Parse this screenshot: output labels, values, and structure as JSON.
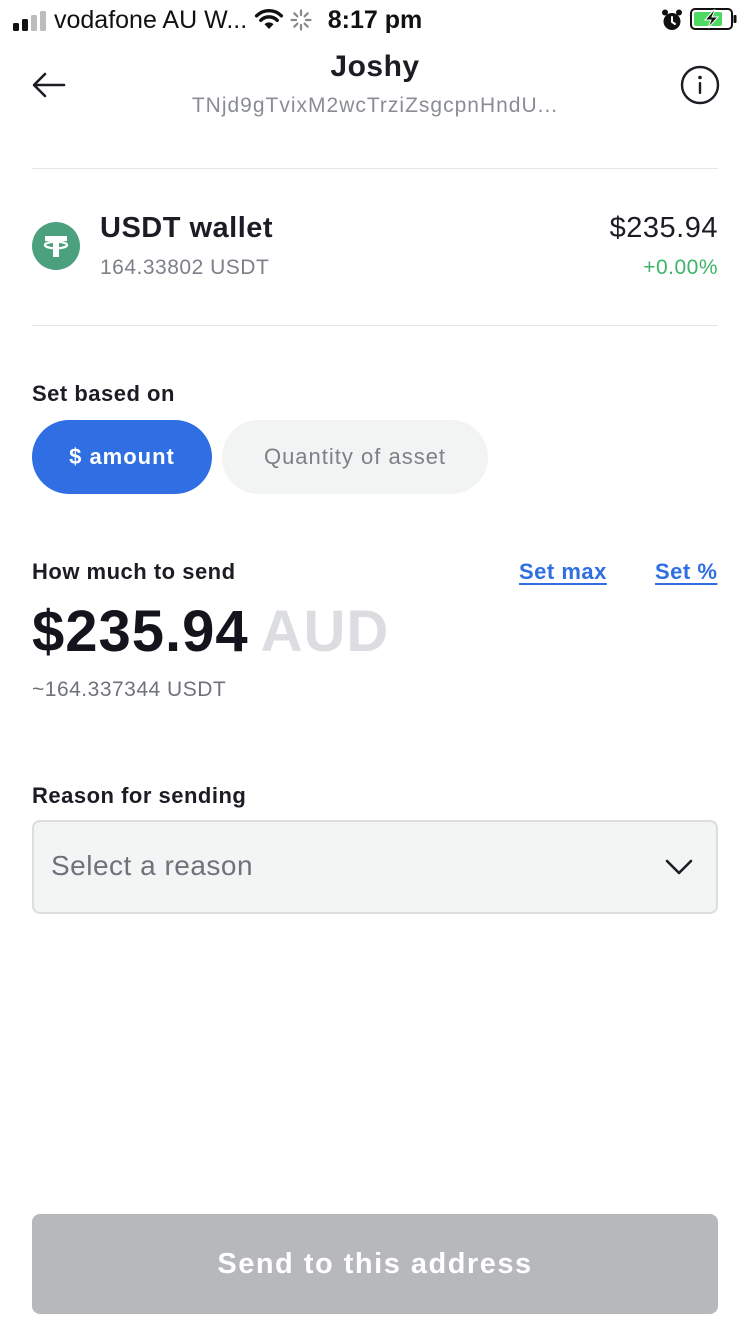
{
  "status_bar": {
    "carrier": "vodafone AU W...",
    "time": "8:17 pm",
    "icons": [
      "signal-icon",
      "wifi-icon",
      "activity-spinner-icon",
      "alarm-icon",
      "battery-charging-icon"
    ]
  },
  "header": {
    "title": "Joshy",
    "address": "TNjd9gTvixM2wcTrziZsgcpnHndU...",
    "back_icon": "arrow-left-icon",
    "info_icon": "info-icon"
  },
  "wallet": {
    "name": "USDT wallet",
    "quantity": "164.33802 USDT",
    "value": "$235.94",
    "change": "+0.00%",
    "icon": "tether-icon"
  },
  "set_based_on": {
    "label": "Set based on",
    "options": [
      "$ amount",
      "Quantity of asset"
    ],
    "selected": "$ amount"
  },
  "send_amount": {
    "label": "How much to send",
    "set_max": "Set max",
    "set_percent": "Set %",
    "amount": "$235.94",
    "currency": "AUD",
    "approx": "~164.337344 USDT"
  },
  "reason": {
    "label": "Reason for sending",
    "placeholder": "Select a reason"
  },
  "footer": {
    "send_button": "Send to this address"
  },
  "colors": {
    "accent": "#2f6fe3",
    "positive": "#3cb46a",
    "tether": "#4ba07e",
    "disabled_button": "#b6b8bc"
  }
}
